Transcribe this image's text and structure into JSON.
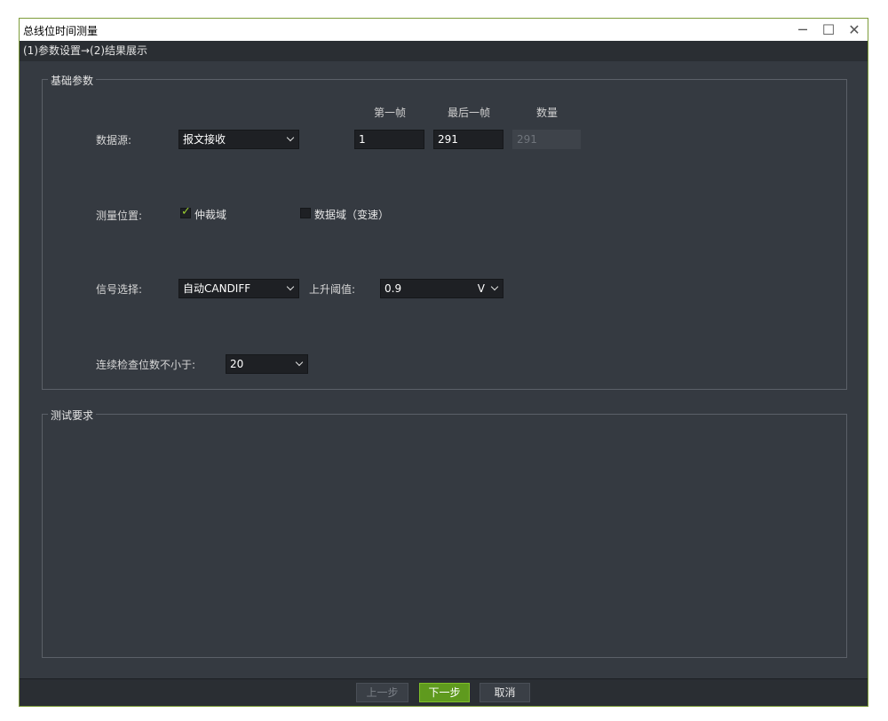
{
  "window": {
    "title": "总线位时间测量",
    "minimize_label": "─",
    "maximize_label": "☐",
    "close_label": "✕"
  },
  "steps": "(1)参数设置→(2)结果展示",
  "basic": {
    "title": "基础参数",
    "headers": {
      "first": "第一帧",
      "last": "最后一帧",
      "count": "数量"
    },
    "data_source": {
      "label": "数据源:",
      "value": "报文接收",
      "first": "1",
      "last": "291",
      "count": "291"
    },
    "position": {
      "label": "测量位置:",
      "option1": {
        "label": "仲裁域",
        "checked": true
      },
      "option2": {
        "label": "数据域（变速）",
        "checked": false
      }
    },
    "signal": {
      "label": "信号选择:",
      "value": "自动CANDIFF",
      "threshold_label": "上升阈值:",
      "threshold_value": "0.9",
      "threshold_unit": "V"
    },
    "consecutive": {
      "label": "连续检查位数不小于:",
      "value": "20"
    }
  },
  "requirements": {
    "title": "测试要求"
  },
  "footer": {
    "prev": "上一步",
    "next": "下一步",
    "cancel": "取消"
  }
}
